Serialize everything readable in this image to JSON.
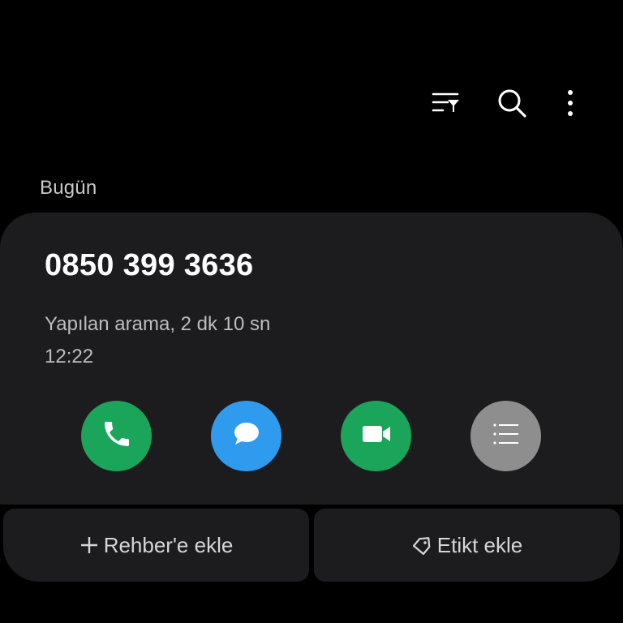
{
  "toolbar": {
    "filter_icon": "filter-list-icon",
    "search_icon": "search-icon",
    "more_icon": "more-vertical-icon"
  },
  "section": {
    "header": "Bugün"
  },
  "call": {
    "number": "0850 399 3636",
    "detail": "Yapılan arama, 2 dk 10 sn",
    "time": "12:22"
  },
  "actions": {
    "call_icon": "phone-icon",
    "message_icon": "message-icon",
    "video_icon": "video-call-icon",
    "details_icon": "details-list-icon"
  },
  "bottom": {
    "add_contact_label": "Rehber'e ekle",
    "add_tag_label": "Etikt ekle"
  },
  "colors": {
    "background": "#000000",
    "card": "#1c1c1e",
    "call_green": "#1aa55a",
    "message_blue": "#2f9bef",
    "video_green": "#1aa55a",
    "details_gray": "#8e8e8e",
    "secondary_text": "#bdbdbd"
  }
}
